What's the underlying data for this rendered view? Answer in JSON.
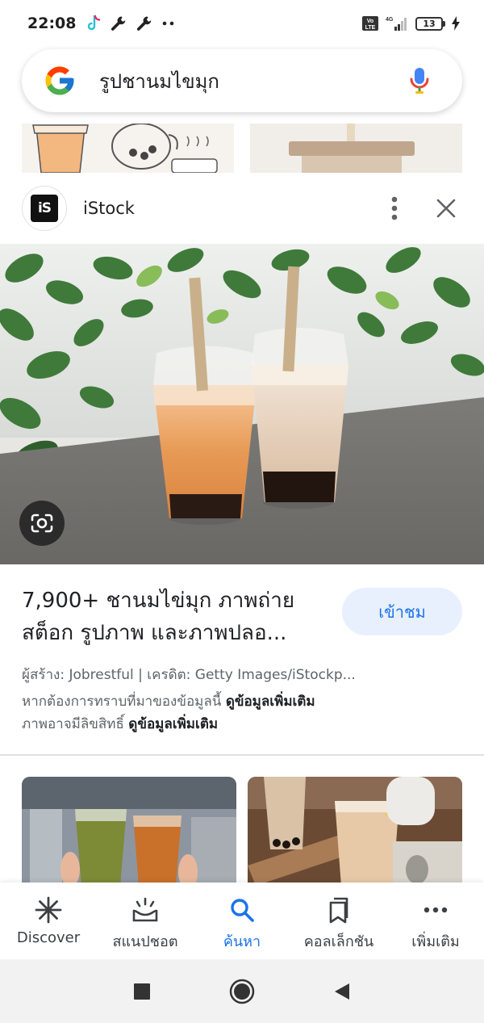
{
  "status_bar": {
    "time": "22:08",
    "network": "4G",
    "volte": "Vo LTE",
    "battery": "13"
  },
  "search": {
    "query": "รูปชานมไขมุก"
  },
  "source": {
    "name": "iStock",
    "logo_text": "iS"
  },
  "result": {
    "title_line1": "7,900+ ชานมไข่มุก ภาพถ่าย",
    "title_line2": "สต็อก รูปภาพ และภาพปลอ...",
    "visit_label": "เข้าชม",
    "credit": "ผู้สร้าง: Jobrestful | เครดิต: Getty Images/iStockp...",
    "info_prefix": "หากต้องการทราบที่มาของข้อมูลนี้",
    "info_link": "ดูข้อมูลเพิ่มเติม",
    "copyright_prefix": "ภาพอาจมีลิขสิทธิ์",
    "copyright_link": "ดูข้อมูลเพิ่มเติม"
  },
  "bottom_nav": {
    "items": [
      {
        "label": "Discover",
        "icon": "asterisk-icon"
      },
      {
        "label": "สแนปชอต",
        "icon": "snapshot-icon"
      },
      {
        "label": "ค้นหา",
        "icon": "search-icon"
      },
      {
        "label": "คอลเล็กชัน",
        "icon": "collections-icon"
      },
      {
        "label": "เพิ่มเติม",
        "icon": "more-horizontal-icon"
      }
    ],
    "active_index": 2
  },
  "colors": {
    "accent": "#1a73e8",
    "visit_bg": "#e8f0fe"
  }
}
